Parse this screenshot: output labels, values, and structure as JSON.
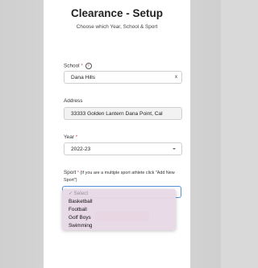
{
  "header": {
    "title": "Clearance - Setup",
    "subtitle": "Choose which Year, School & Sport"
  },
  "school": {
    "label": "School",
    "required_mark": "*",
    "value": "Dana Hills",
    "clear_glyph": "x",
    "help_glyph": "?"
  },
  "address": {
    "label": "Address",
    "value": "33333 Golden Lantern Dana Point, Cal"
  },
  "year": {
    "label": "Year",
    "required_mark": "*",
    "value": "2022-23"
  },
  "sport": {
    "label": "Sport",
    "required_mark": "*",
    "hint": "(If you are a multiple sport athlete click \"Add New Sport\")",
    "dropdown": {
      "check_glyph": "✓",
      "placeholder": "Select",
      "options": [
        "Basketball",
        "Football",
        "Golf Boys",
        "Swimming"
      ]
    }
  },
  "colors": {
    "accent_orange": "#f5a55c",
    "focus_blue": "#5b8fd8",
    "required_red": "#d9534f",
    "dropdown_bg": "#e7d9e6"
  },
  "icons": {
    "help": "question-circle-icon",
    "clear": "close-icon",
    "caret": "chevron-down-icon",
    "check": "check-icon"
  }
}
